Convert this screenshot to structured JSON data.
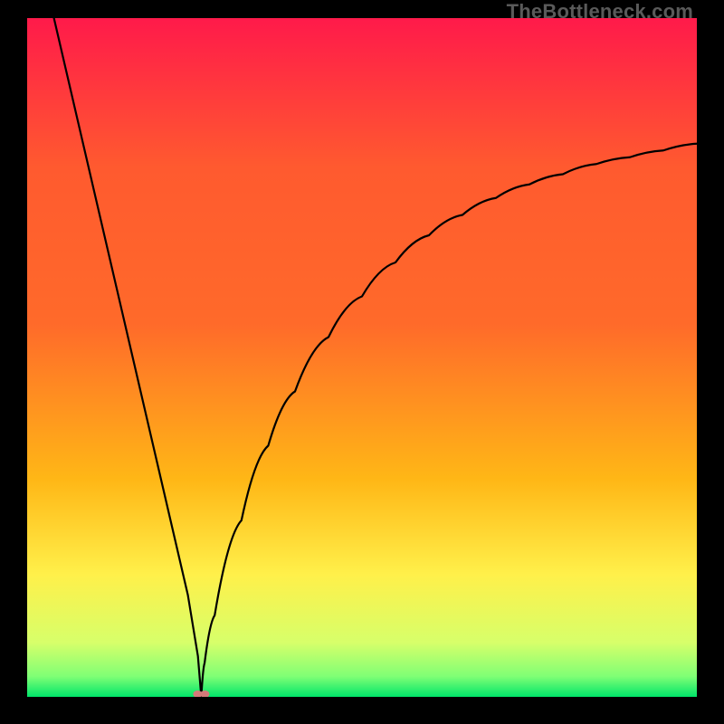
{
  "watermark": "TheBottleneck.com",
  "chart_data": {
    "type": "line",
    "title": "",
    "xlabel": "",
    "ylabel": "",
    "xlim": [
      0,
      100
    ],
    "ylim": [
      0,
      100
    ],
    "background_gradient": {
      "top": "#ff1a4a",
      "upper_mid": "#ff6a2a",
      "mid": "#ffb716",
      "lower_mid": "#fff04a",
      "near_bottom": "#d7ff6a",
      "bottom": "#00e56a"
    },
    "curve_note": "V-shaped curve: steep near-linear descent from top-left to a cusp minimum near x≈26, then a concave-increasing rise toward the right edge reaching ≈82% height.",
    "series": [
      {
        "name": "bottleneck-curve",
        "x": [
          4,
          8,
          12,
          16,
          20,
          24,
          25.5,
          26,
          26.5,
          28,
          32,
          36,
          40,
          45,
          50,
          55,
          60,
          65,
          70,
          75,
          80,
          85,
          90,
          95,
          100
        ],
        "y": [
          100,
          83,
          66,
          49,
          32,
          15,
          6,
          0,
          5,
          12,
          26,
          37,
          45,
          53,
          59,
          64,
          68,
          71,
          73.5,
          75.5,
          77,
          78.5,
          79.5,
          80.5,
          81.5
        ]
      }
    ],
    "marker": {
      "x": 26,
      "y": 0,
      "color": "#d47a7a",
      "note": "small pink double-dot at the cusp minimum"
    }
  }
}
